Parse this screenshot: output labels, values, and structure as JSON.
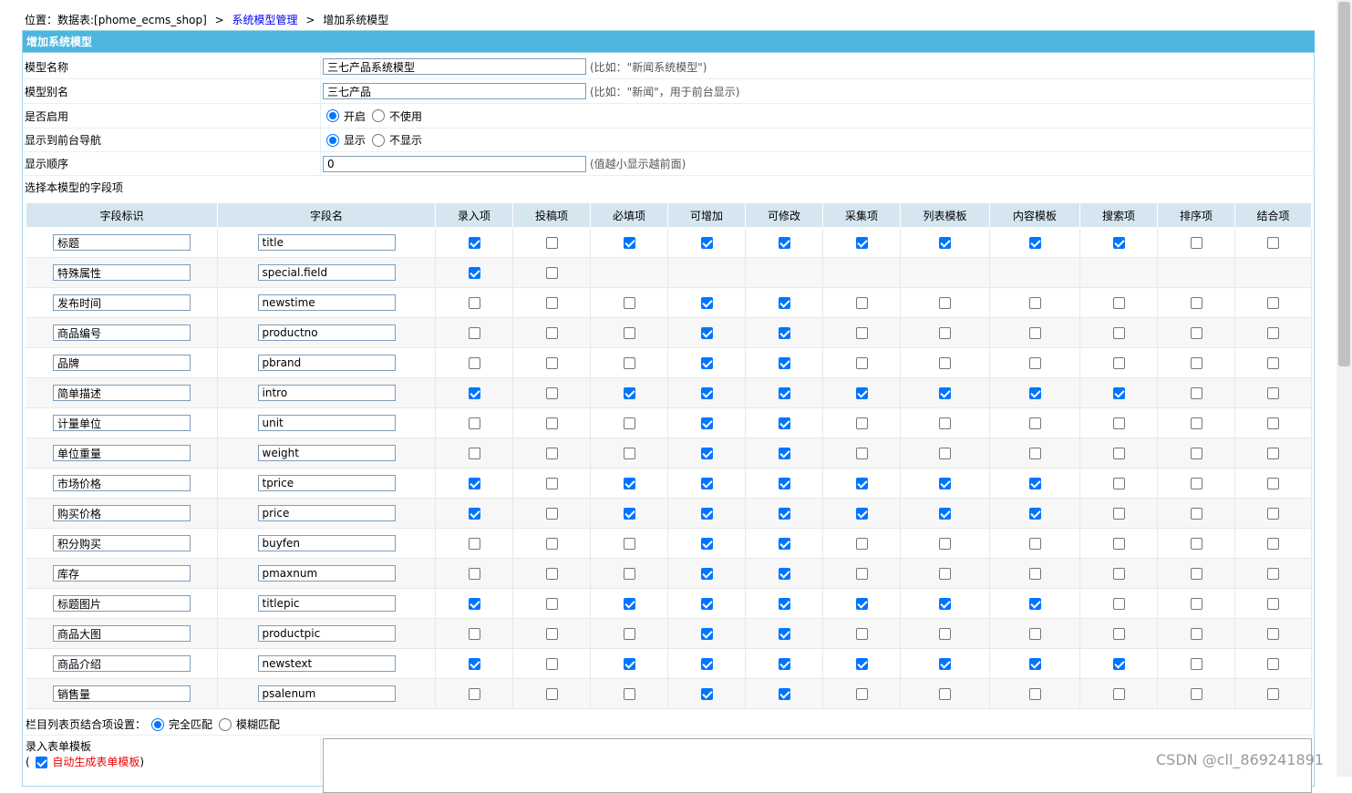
{
  "breadcrumb": {
    "prefix": "位置：数据表:[phome_ecms_shop]",
    "sep1": ">",
    "link": "系统模型管理",
    "sep2": ">",
    "current": "增加系统模型"
  },
  "header": {
    "title": "增加系统模型"
  },
  "form": {
    "model_name": {
      "label": "模型名称",
      "value": "三七产品系统模型",
      "hint": "(比如：\"新闻系统模型\")"
    },
    "model_alias": {
      "label": "模型别名",
      "value": "三七产品",
      "hint": "(比如：\"新闻\"，用于前台显示)"
    },
    "enabled": {
      "label": "是否启用",
      "opt_on": "开启",
      "opt_off": "不使用",
      "selected": "开启"
    },
    "show_nav": {
      "label": "显示到前台导航",
      "opt_on": "显示",
      "opt_off": "不显示",
      "selected": "显示"
    },
    "order": {
      "label": "显示顺序",
      "value": "0",
      "hint": "(值越小显示越前面)"
    },
    "select_fields_label": "选择本模型的字段项"
  },
  "table": {
    "headers": [
      "字段标识",
      "字段名",
      "录入项",
      "投稿项",
      "必填项",
      "可增加",
      "可修改",
      "采集项",
      "列表模板",
      "内容模板",
      "搜索项",
      "排序项",
      "结合项"
    ],
    "rows": [
      {
        "label": "标题",
        "name": "title",
        "checks": [
          1,
          0,
          1,
          1,
          1,
          1,
          1,
          1,
          1,
          0,
          0
        ]
      },
      {
        "label": "特殊属性",
        "name": "special.field",
        "checks": [
          1,
          0,
          null,
          null,
          null,
          null,
          null,
          null,
          null,
          null,
          null
        ]
      },
      {
        "label": "发布时间",
        "name": "newstime",
        "checks": [
          0,
          0,
          0,
          1,
          1,
          0,
          0,
          0,
          0,
          0,
          0
        ]
      },
      {
        "label": "商品编号",
        "name": "productno",
        "checks": [
          0,
          0,
          0,
          1,
          1,
          0,
          0,
          0,
          0,
          0,
          0
        ]
      },
      {
        "label": "品牌",
        "name": "pbrand",
        "checks": [
          0,
          0,
          0,
          1,
          1,
          0,
          0,
          0,
          0,
          0,
          0
        ]
      },
      {
        "label": "简单描述",
        "name": "intro",
        "checks": [
          1,
          0,
          1,
          1,
          1,
          1,
          1,
          1,
          1,
          0,
          0
        ]
      },
      {
        "label": "计量单位",
        "name": "unit",
        "checks": [
          0,
          0,
          0,
          1,
          1,
          0,
          0,
          0,
          0,
          0,
          0
        ]
      },
      {
        "label": "单位重量",
        "name": "weight",
        "checks": [
          0,
          0,
          0,
          1,
          1,
          0,
          0,
          0,
          0,
          0,
          0
        ]
      },
      {
        "label": "市场价格",
        "name": "tprice",
        "checks": [
          1,
          0,
          1,
          1,
          1,
          1,
          1,
          1,
          0,
          0,
          0
        ]
      },
      {
        "label": "购买价格",
        "name": "price",
        "checks": [
          1,
          0,
          1,
          1,
          1,
          1,
          1,
          1,
          0,
          0,
          0
        ]
      },
      {
        "label": "积分购买",
        "name": "buyfen",
        "checks": [
          0,
          0,
          0,
          1,
          1,
          0,
          0,
          0,
          0,
          0,
          0
        ]
      },
      {
        "label": "库存",
        "name": "pmaxnum",
        "checks": [
          0,
          0,
          0,
          1,
          1,
          0,
          0,
          0,
          0,
          0,
          0
        ]
      },
      {
        "label": "标题图片",
        "name": "titlepic",
        "checks": [
          1,
          0,
          1,
          1,
          1,
          1,
          1,
          1,
          0,
          0,
          0
        ]
      },
      {
        "label": "商品大图",
        "name": "productpic",
        "checks": [
          0,
          0,
          0,
          1,
          1,
          0,
          0,
          0,
          0,
          0,
          0
        ]
      },
      {
        "label": "商品介绍",
        "name": "newstext",
        "checks": [
          1,
          0,
          1,
          1,
          1,
          1,
          1,
          1,
          1,
          0,
          0
        ]
      },
      {
        "label": "销售量",
        "name": "psalenum",
        "checks": [
          0,
          0,
          0,
          1,
          1,
          0,
          0,
          0,
          0,
          0,
          0
        ]
      }
    ]
  },
  "combine": {
    "label": "栏目列表页结合项设置：",
    "opt_exact": "完全匹配",
    "opt_fuzzy": "模糊匹配",
    "selected": "完全匹配"
  },
  "input_template": {
    "label": "录入表单模板",
    "open_paren": "(",
    "auto_label": "自动生成表单模板",
    "close_paren": ")",
    "auto_checked": true
  },
  "watermark": "CSDN @cll_869241891"
}
